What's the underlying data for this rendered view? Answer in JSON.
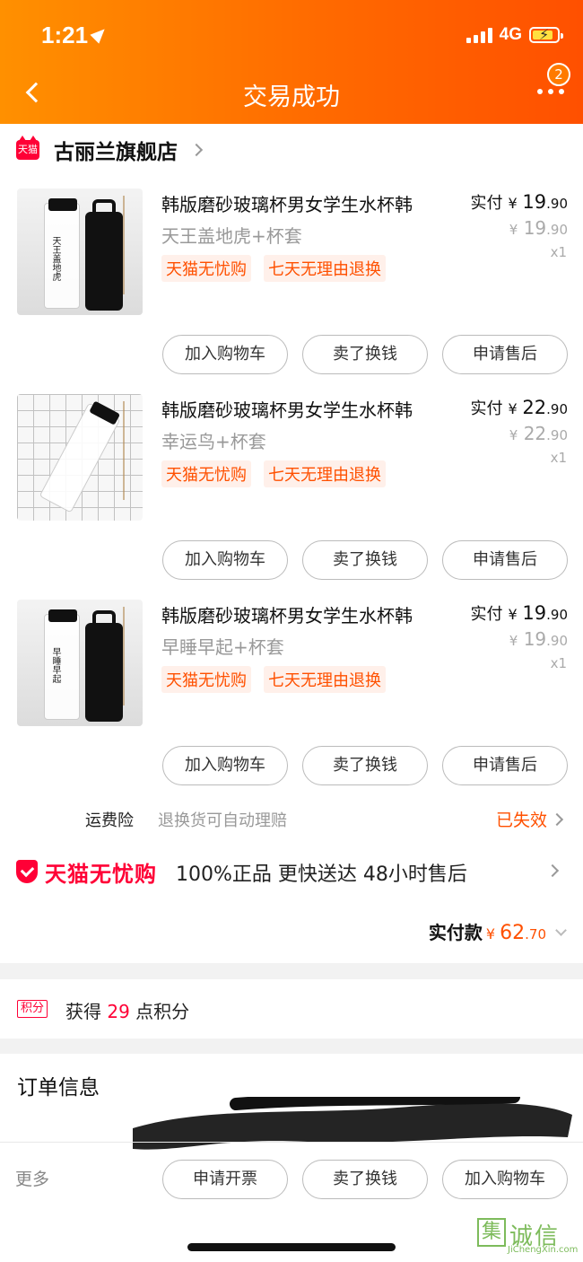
{
  "status_bar": {
    "time": "1:21",
    "network": "4G"
  },
  "header": {
    "title": "交易成功",
    "badge_count": "2"
  },
  "shop": {
    "tag": "天猫",
    "name": "古丽兰旗舰店"
  },
  "items": [
    {
      "name": "韩版磨砂玻璃杯男女学生水杯韩",
      "sku": "天王盖地虎+杯套",
      "tags": [
        "天猫无忧购",
        "七天无理由退换"
      ],
      "paid_label": "实付",
      "currency": "¥",
      "paid_int": "19",
      "paid_dec": ".90",
      "orig_int": "19",
      "orig_dec": ".90",
      "qty": "x1",
      "bottle_text": "天王盖地虎"
    },
    {
      "name": "韩版磨砂玻璃杯男女学生水杯韩",
      "sku": "幸运鸟+杯套",
      "tags": [
        "天猫无忧购",
        "七天无理由退换"
      ],
      "paid_label": "实付",
      "currency": "¥",
      "paid_int": "22",
      "paid_dec": ".90",
      "orig_int": "22",
      "orig_dec": ".90",
      "qty": "x1",
      "bottle_text": ""
    },
    {
      "name": "韩版磨砂玻璃杯男女学生水杯韩",
      "sku": "早睡早起+杯套",
      "tags": [
        "天猫无忧购",
        "七天无理由退换"
      ],
      "paid_label": "实付",
      "currency": "¥",
      "paid_int": "19",
      "paid_dec": ".90",
      "orig_int": "19",
      "orig_dec": ".90",
      "qty": "x1",
      "bottle_text": "早睡早起"
    }
  ],
  "item_buttons": [
    "加入购物车",
    "卖了换钱",
    "申请售后"
  ],
  "freight": {
    "label": "运费险",
    "desc": "退换货可自动理赔",
    "status": "已失效"
  },
  "assurance": {
    "brand": "天猫无忧购",
    "points": "100%正品  更快送达  48小时售后"
  },
  "total": {
    "label": "实付款",
    "currency": "¥",
    "int": "62",
    "dec": ".70"
  },
  "points": {
    "tag": "积分",
    "prefix": "获得",
    "value": "29",
    "suffix": "点积分"
  },
  "order_info": {
    "title": "订单信息"
  },
  "bottom_bar": {
    "more": "更多",
    "buttons": [
      "申请开票",
      "卖了换钱",
      "加入购物车"
    ]
  },
  "watermark": {
    "text": "诚信",
    "sub": "JiChengXin.com",
    "box": "集"
  },
  "colors": {
    "accent": "#ff5000",
    "tmall_red": "#ff0036",
    "header_start": "#ff9000",
    "header_end": "#ff5000"
  }
}
